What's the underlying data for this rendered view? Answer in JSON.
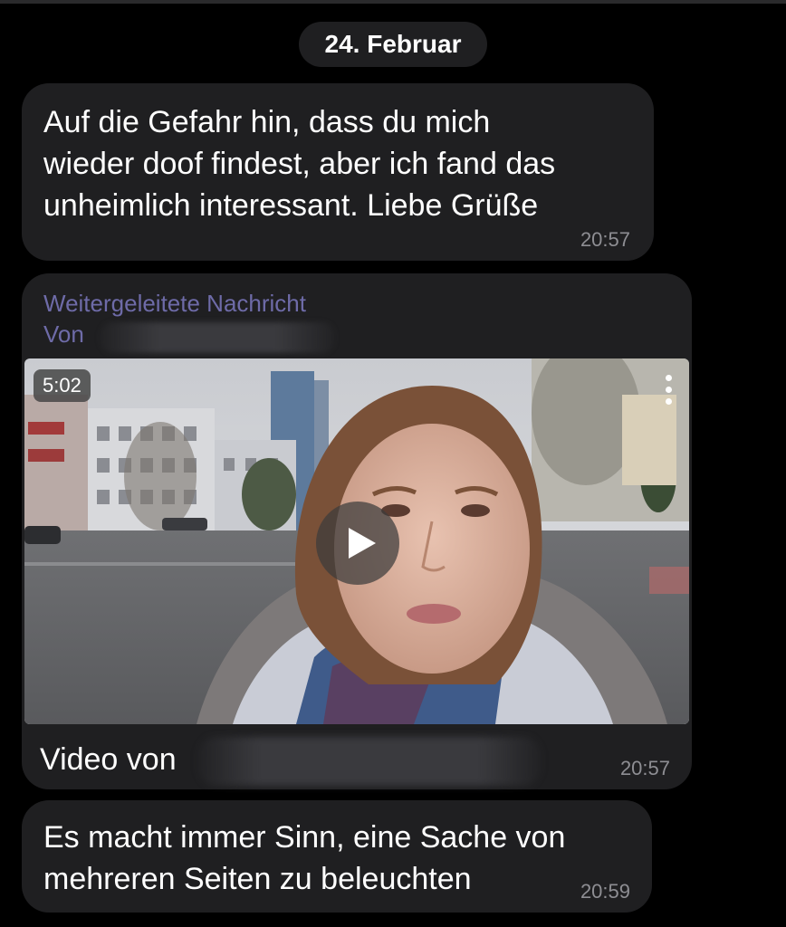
{
  "chat": {
    "date_label": "24. Februar",
    "messages": [
      {
        "text": "Auf die Gefahr hin, dass du mich\nwieder doof findest, aber ich fand das\nunheimlich interessant. Liebe Grüße",
        "time": "20:57"
      },
      {
        "forwarded_label": "Weitergeleitete Nachricht",
        "from_label": "Von",
        "video_duration": "5:02",
        "caption": "Video von",
        "time": "20:57"
      },
      {
        "text": "Es macht immer Sinn, eine Sache von\nmehreren Seiten zu beleuchten",
        "time": "20:59"
      }
    ]
  },
  "icons": {
    "play": "play-icon",
    "menu": "more-vertical-icon"
  },
  "colors": {
    "background": "#000000",
    "bubble": "#1f1f21",
    "forward_label": "#6e6ba8",
    "timestamp": "#8e8e93"
  }
}
